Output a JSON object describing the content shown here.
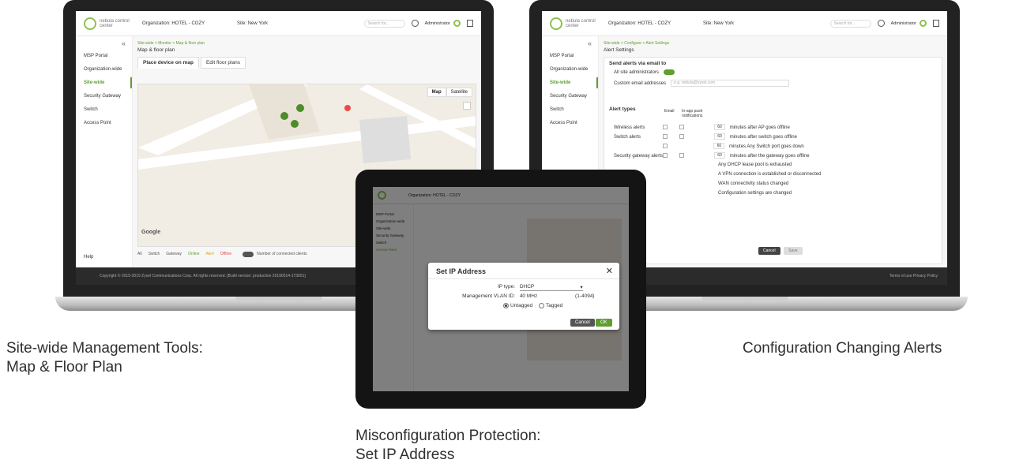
{
  "captions": {
    "left": [
      "Site-wide Management Tools:",
      "Map & Floor Plan"
    ],
    "right": "Configuration Changing Alerts",
    "center": [
      "Misconfiguration Protection:",
      "Set IP Address"
    ]
  },
  "app": {
    "brand": "nebula control center",
    "org_label": "Organization: HOTEL - COZY",
    "site_label": "Site: New York",
    "search_placeholder": "Search for...",
    "admin_label": "Administrator",
    "sidebar": [
      "MSP Portal",
      "Organization-wide",
      "Site-wide",
      "Security Gateway",
      "Switch",
      "Access Point"
    ],
    "help_label": "Help",
    "footer_left": "Copyright © 2015-2019 Zyxel Communications Corp. All rights reserved. [Build version: production 20190514-173651]",
    "footer_right": "Terms of use   Privacy Policy"
  },
  "map_screen": {
    "breadcrumb": "Site-wide > Monitor > Map & floor plan",
    "title": "Map & floor plan",
    "tabs": [
      "Place device on map",
      "Edit floor plans"
    ],
    "map_buttons": [
      "Map",
      "Satellite"
    ],
    "google": "Google",
    "legend": [
      "All",
      "Switch",
      "Gateway",
      "Online",
      "Alert",
      "Offline"
    ],
    "legend_note": "Number of connected clients"
  },
  "alerts_screen": {
    "breadcrumb": "Site-wide > Configure > Alert Settings",
    "title": "Alert Settings",
    "send_header": "Send alerts via email to",
    "all_admins": "All site administrators",
    "custom_email": "Custom email addresses",
    "custom_placeholder": "e.g. nebula@zyxel.com",
    "types_header": "Alert types",
    "col_email": "Email",
    "col_push": "In-app push notifications",
    "rows": [
      {
        "label": "Wireless alerts",
        "num": "60",
        "text": "minutes after AP goes offline"
      },
      {
        "label": "Switch alerts",
        "num": "60",
        "text": "minutes after switch goes offline"
      },
      {
        "label": "",
        "num": "60",
        "text": "minutes   Any Switch port   goes down"
      },
      {
        "label": "Security gateway alerts",
        "num": "60",
        "text": "minutes after the gateway goes offline"
      }
    ],
    "extra": [
      "Any DHCP lease pool is exhausted",
      "A VPN connection is established or disconnected",
      "WAN connectivity status changed",
      "Configuration settings are changed"
    ],
    "cancel": "Cancel",
    "save": "Save"
  },
  "tablet": {
    "modal_title": "Set IP Address",
    "ip_type_label": "IP type:",
    "ip_type_value": "DHCP",
    "vlan_label": "Management VLAN ID:",
    "vlan_value": "40 MHz",
    "vlan_range": "(1-4094)",
    "untagged": "Untagged",
    "tagged": "Tagged",
    "cancel": "Cancel",
    "ok": "OK"
  },
  "colors": {
    "accent": "#5f9e2f",
    "dark": "#2b2b2b"
  }
}
